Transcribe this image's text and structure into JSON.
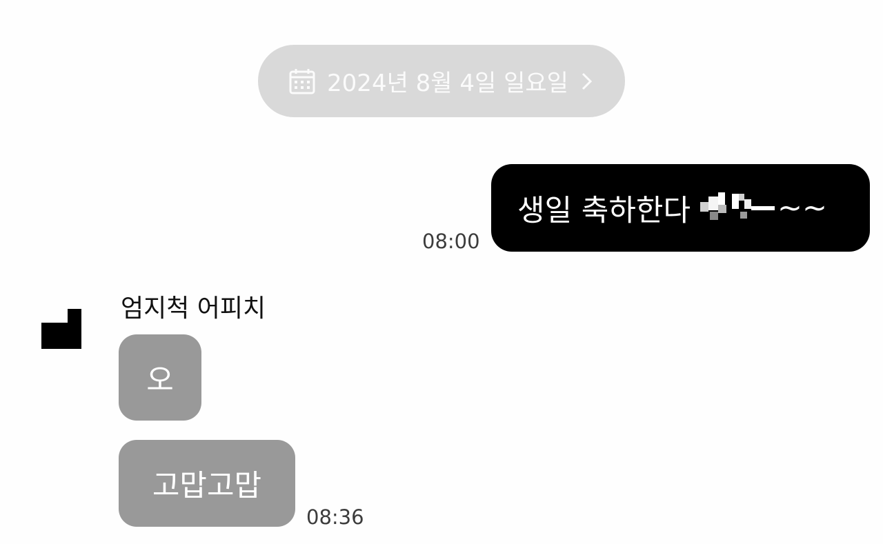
{
  "date_divider": {
    "icon": "calendar-icon",
    "text": "2024년 8월 4일 일요일",
    "chevron": "chevron-right-icon"
  },
  "outgoing": {
    "message": "생일 축하한다",
    "suffix": "~~",
    "time": "08:00",
    "redacted": true
  },
  "incoming": {
    "sender_name": "엄지척 어피치",
    "messages": [
      "오",
      "고맙고맙"
    ],
    "time": "08:36"
  },
  "colors": {
    "background": "#fefefe",
    "date_pill": "#d9d9d9",
    "outgoing_bubble": "#000000",
    "incoming_bubble": "#999999",
    "timestamp": "#3c3c3c"
  }
}
